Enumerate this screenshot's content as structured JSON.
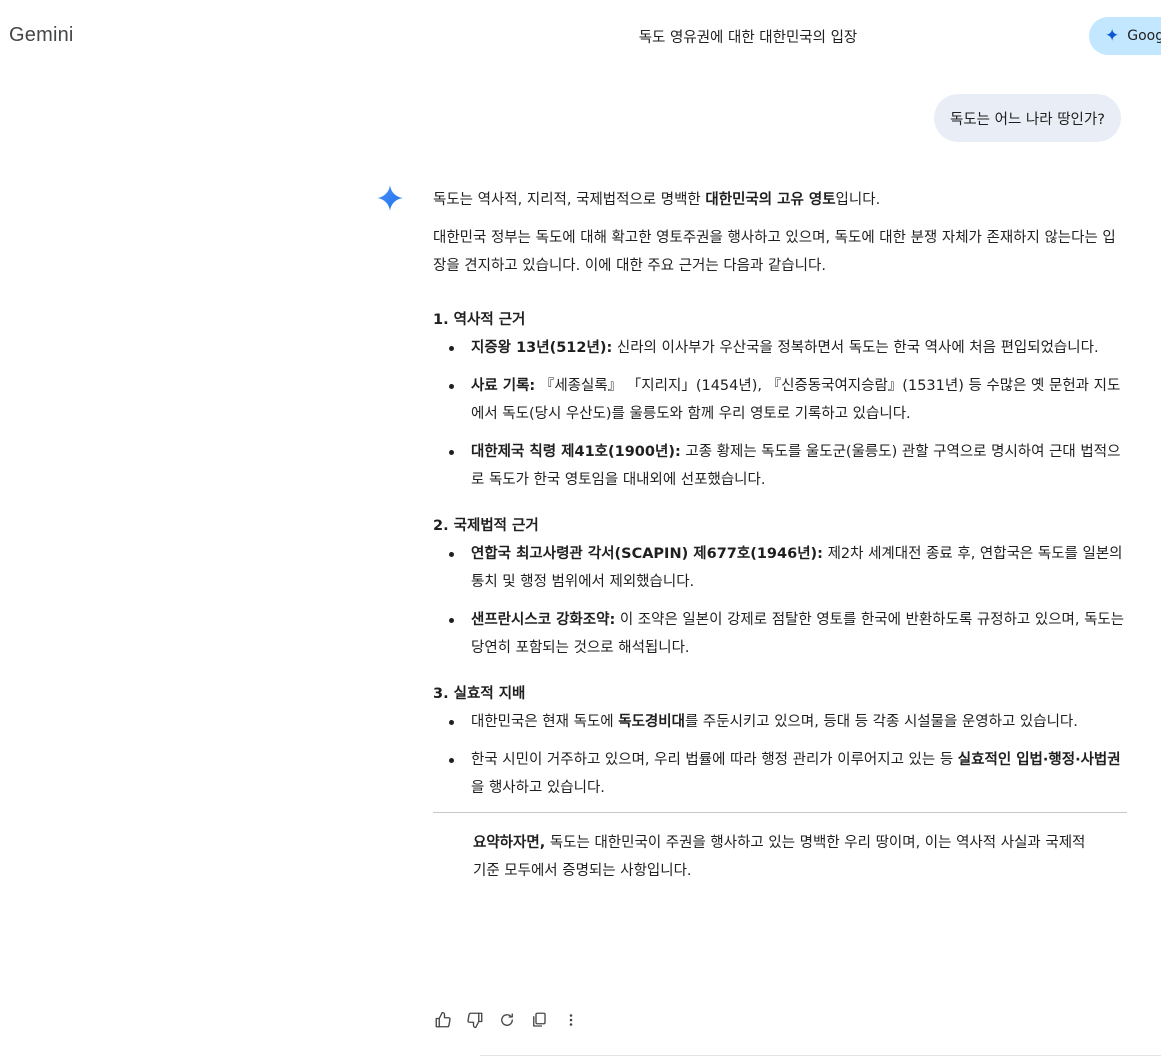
{
  "app": {
    "name": "Gemini"
  },
  "header": {
    "conversation_title": "독도 영유권에 대한 대한민국의 입장",
    "upgrade_label": "Google"
  },
  "user_message": "독도는 어느 나라 땅인가?",
  "response": {
    "intro": {
      "before": "독도는 역사적, 지리적, 국제법적으로 명백한 ",
      "bold": "대한민국의 고유 영토",
      "after": "입니다."
    },
    "para2": "대한민국 정부는 독도에 대해 확고한 영토주권을 행사하고 있으며, 독도에 대한 분쟁 자체가 존재하지 않는다는 입장을 견지하고 있습니다. 이에 대한 주요 근거는 다음과 같습니다.",
    "sections": [
      {
        "heading": "1. 역사적 근거",
        "items": [
          {
            "bold": "지증왕 13년(512년):",
            "text": " 신라의 이사부가 우산국을 정복하면서 독도는 한국 역사에 처음 편입되었습니다."
          },
          {
            "bold": "사료 기록:",
            "text": " 『세종실록』 「지리지」(1454년), 『신증동국여지승람』(1531년) 등 수많은 옛 문헌과 지도에서 독도(당시 우산도)를 울릉도와 함께 우리 영토로 기록하고 있습니다."
          },
          {
            "bold": "대한제국 칙령 제41호(1900년):",
            "text": " 고종 황제는 독도를 울도군(울릉도) 관할 구역으로 명시하여 근대 법적으로 독도가 한국 영토임을 대내외에 선포했습니다."
          }
        ]
      },
      {
        "heading": "2. 국제법적 근거",
        "items": [
          {
            "bold": "연합국 최고사령관 각서(SCAPIN) 제677호(1946년):",
            "text": " 제2차 세계대전 종료 후, 연합국은 독도를 일본의 통치 및 행정 범위에서 제외했습니다."
          },
          {
            "bold": "샌프란시스코 강화조약:",
            "text": " 이 조약은 일본이 강제로 점탈한 영토를 한국에 반환하도록 규정하고 있으며, 독도는 당연히 포함되는 것으로 해석됩니다."
          }
        ]
      },
      {
        "heading": "3. 실효적 지배",
        "items": [
          {
            "pre": "대한민국은 현재 독도에 ",
            "bold": "독도경비대",
            "text": "를 주둔시키고 있으며, 등대 등 각종 시설물을 운영하고 있습니다."
          },
          {
            "pre": "한국 시민이 거주하고 있으며, 우리 법률에 따라 행정 관리가 이루어지고 있는 등 ",
            "bold": "실효적인 입법·행정·사법권",
            "text": "을 행사하고 있습니다."
          }
        ]
      }
    ],
    "summary": {
      "bold": "요약하자면,",
      "text": " 독도는 대한민국이 주권을 행사하고 있는 명백한 우리 땅이며, 이는 역사적 사실과 국제적 기준 모두에서 증명되는 사항입니다."
    }
  },
  "actions": {
    "icons": [
      "thumbs-up-icon",
      "thumbs-down-icon",
      "redo-icon",
      "copy-icon",
      "more-vert-icon"
    ]
  },
  "colors": {
    "accent": "#0b57d0",
    "user_bubble": "#e9eef6",
    "upgrade_chip": "#c2e7ff",
    "text": "#1f1f1f"
  }
}
